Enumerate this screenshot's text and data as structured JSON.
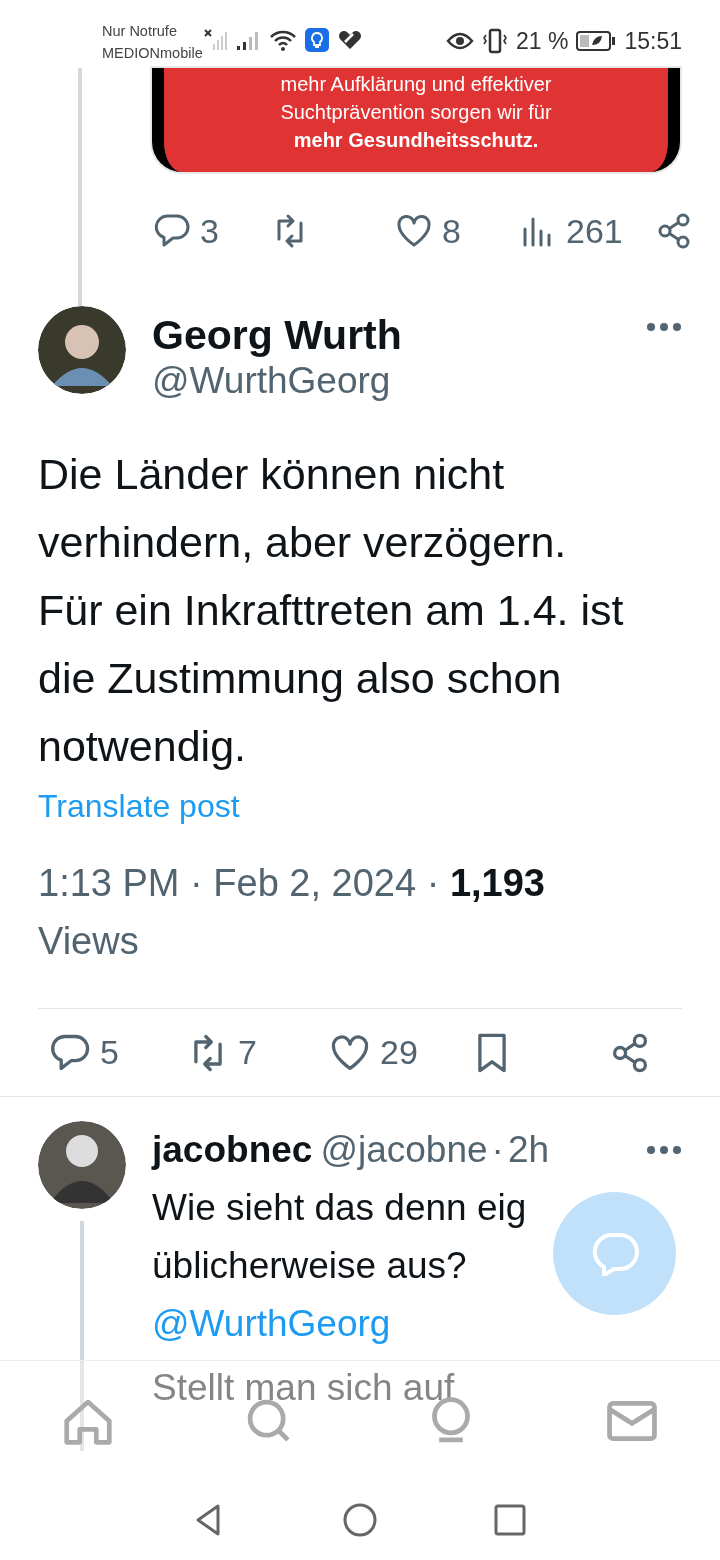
{
  "status_bar": {
    "carrier_lines": [
      "Nur Notrufe",
      "MEDIONmobile"
    ],
    "battery": "21 %",
    "time": "15:51"
  },
  "previous_post": {
    "image_text": "mehr Aufklärung und effektiver Suchtprävention sorgen wir für **mehr Gesundheitsschutz.**",
    "actions": [
      {
        "kind": "reply",
        "count": "3"
      },
      {
        "kind": "repost"
      },
      {
        "kind": "like",
        "count": "8"
      },
      {
        "kind": "views",
        "count": "261"
      },
      {
        "kind": "share"
      }
    ]
  },
  "post": {
    "name": "Georg Wurth",
    "handle": "@WurthGeorg",
    "text": "Die Länder können nicht verhindern, aber verzögern. Für ein Inkrafttreten am 1.4. ist die Zustimmung also schon notwendig.",
    "translate": "Translate post",
    "meta": "1:13 PM · Feb 2, 2024 · **1,193** Views",
    "actions": [
      {
        "kind": "reply",
        "count": "5"
      },
      {
        "kind": "repost",
        "count": "7"
      },
      {
        "kind": "like",
        "count": "29"
      },
      {
        "kind": "bookmark"
      },
      {
        "kind": "share"
      }
    ]
  },
  "reply": {
    "name": "jacobnec",
    "handle": "@jacobne",
    "separator": "·",
    "time": "2h",
    "lines": [
      "Wie sieht das denn eig",
      "üblicherweise aus?"
    ],
    "mention": "@WurthGeorg",
    "text_after": "Stellt man sich auf"
  },
  "bottom_nav": [
    {
      "kind": "home"
    },
    {
      "kind": "search"
    },
    {
      "kind": "spaces"
    },
    {
      "kind": "messages"
    }
  ],
  "system_nav": [
    {
      "kind": "back"
    },
    {
      "kind": "home"
    },
    {
      "kind": "recents"
    }
  ]
}
